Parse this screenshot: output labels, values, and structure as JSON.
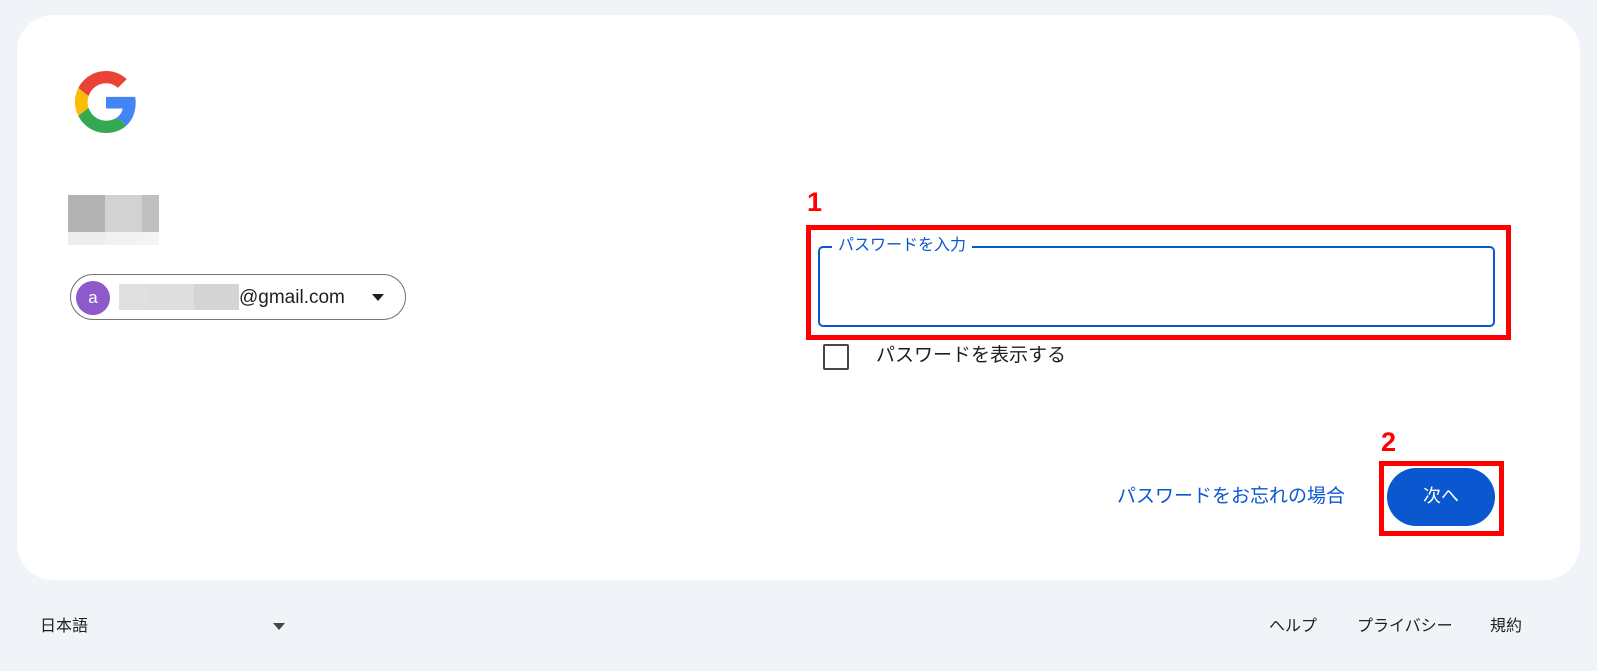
{
  "account": {
    "avatar_initial": "a",
    "email_suffix": "@gmail.com"
  },
  "password": {
    "label": "パスワードを入力",
    "value": "",
    "show_password_label": "パスワードを表示する",
    "show_password_checked": false
  },
  "actions": {
    "forgot_password": "パスワードをお忘れの場合",
    "next": "次へ"
  },
  "annotations": {
    "step1": "1",
    "step2": "2"
  },
  "footer": {
    "language": "日本語",
    "help": "ヘルプ",
    "privacy": "プライバシー",
    "terms": "規約"
  },
  "colors": {
    "page_background": "#f0f4f9",
    "card_background": "#ffffff",
    "accent": "#0b57d0",
    "annotation": "#ff0000",
    "avatar": "#8e59c9"
  }
}
